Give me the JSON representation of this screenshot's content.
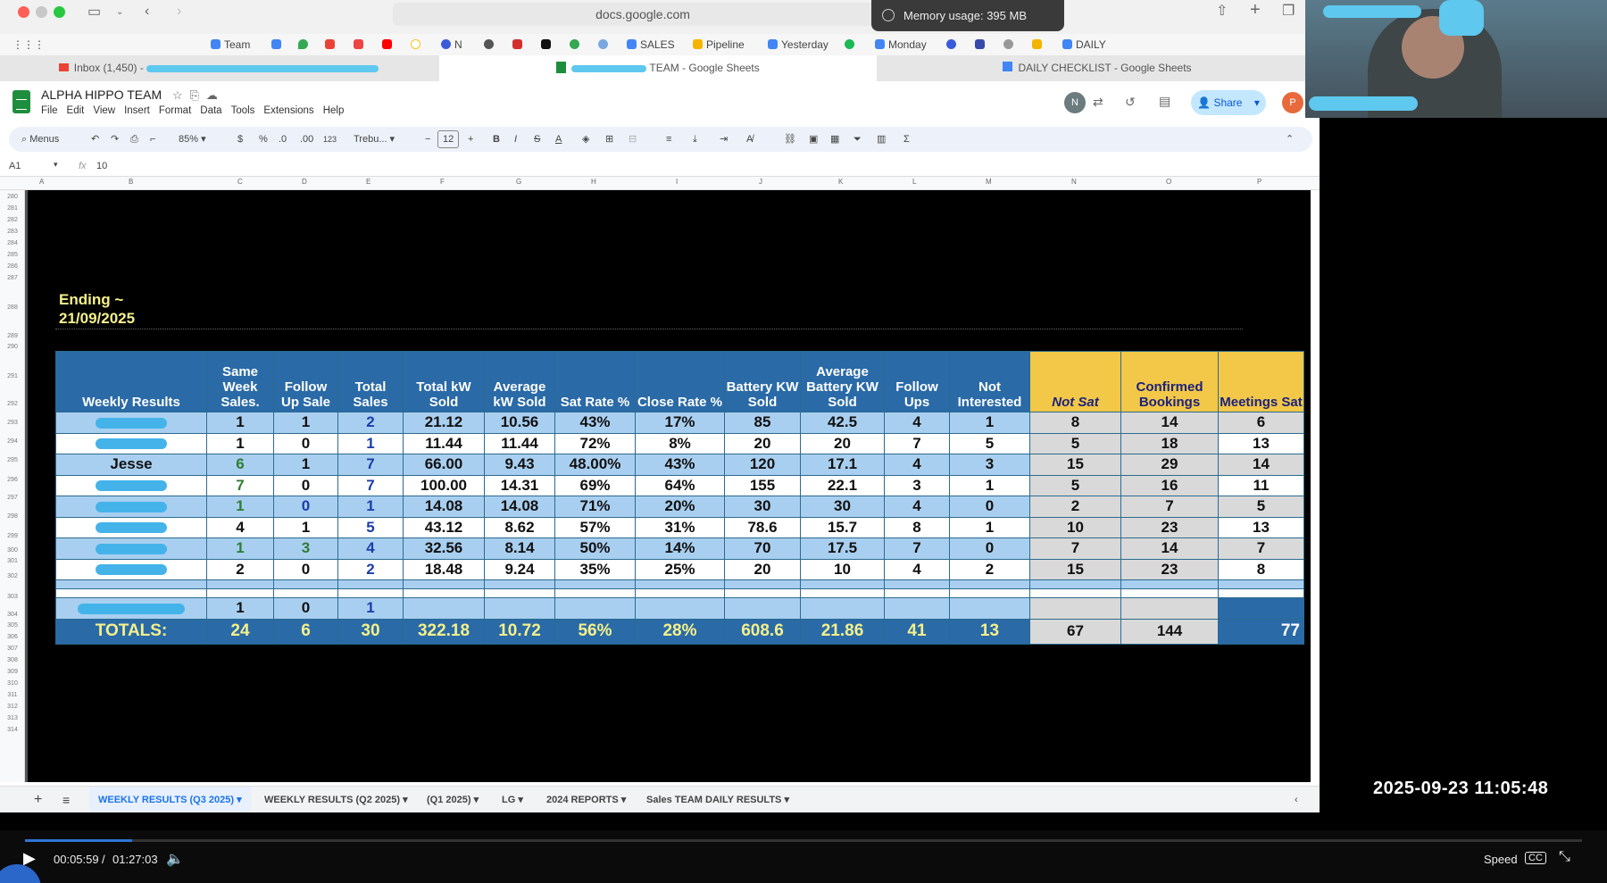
{
  "browser": {
    "url": "docs.google.com",
    "memory_label": "Memory usage: 395 MB",
    "bookmarks": [
      "Team",
      "N",
      "SALES",
      "Pipeline",
      "Yesterday",
      "Monday",
      "DAILY"
    ],
    "tabs": [
      "Inbox (1,450) -",
      "TEAM - Google Sheets",
      "DAILY CHECKLIST - Google Sheets"
    ]
  },
  "sheets": {
    "title": "ALPHA HIPPO TEAM",
    "menu": [
      "File",
      "Edit",
      "View",
      "Insert",
      "Format",
      "Data",
      "Tools",
      "Extensions",
      "Help"
    ],
    "share_label": "Share",
    "avatar_n": "N",
    "avatar_p": "P",
    "toolbar": {
      "menus": "Menus",
      "zoom": "85%",
      "dollar": "$",
      "percent": "%",
      "dec_less": ".0",
      "dec_more": ".00",
      "num_fmt": "123",
      "font": "Trebu...",
      "font_size": "12",
      "bold": "B",
      "italic": "I",
      "sum": "Σ"
    },
    "cell_ref": "A1",
    "fx_label": "fx",
    "formula": "10",
    "col_letters": [
      "A",
      "B",
      "C",
      "D",
      "E",
      "F",
      "G",
      "H",
      "I",
      "J",
      "K",
      "L",
      "M",
      "N",
      "O",
      "P"
    ],
    "row_numbers": [
      "280",
      "281",
      "282",
      "283",
      "284",
      "285",
      "286",
      "287",
      "288",
      "289",
      "290",
      "291",
      "292",
      "293",
      "294",
      "295",
      "296",
      "297",
      "298",
      "299",
      "300",
      "301",
      "302",
      "303",
      "304",
      "305",
      "306",
      "307",
      "308",
      "309",
      "310",
      "311",
      "312",
      "313",
      "314"
    ],
    "sheet_tabs": [
      "WEEKLY RESULTS (Q3 2025)",
      "WEEKLY RESULTS (Q2 2025)",
      "(Q1 2025)",
      "LG",
      "2024 REPORTS",
      "Sales TEAM DAILY RESULTS"
    ]
  },
  "report": {
    "ending_label": "Ending ~\n21/09/2025",
    "headers": [
      "Weekly Results",
      "Same Week Sales.",
      "Follow Up Sale",
      "Total Sales",
      "Total kW Sold",
      "Average kW Sold",
      "Sat Rate  %",
      "Close Rate %",
      "Battery KW Sold",
      "Average Battery KW Sold",
      "Follow Ups",
      "Not Interested",
      "Not Sat",
      "Confirmed Bookings",
      "Meetings Sat"
    ],
    "rows": [
      {
        "name": "",
        "same": "1",
        "follow": "1",
        "total": "2",
        "kw": "21.12",
        "avg_kw": "10.56",
        "sat": "43%",
        "close": "17%",
        "batt": "85",
        "avg_batt": "42.5",
        "fups": "4",
        "notint": "1",
        "notsat": "8",
        "conf": "14",
        "meet": "6"
      },
      {
        "name": "",
        "same": "1",
        "follow": "0",
        "total": "1",
        "kw": "11.44",
        "avg_kw": "11.44",
        "sat": "72%",
        "close": "8%",
        "batt": "20",
        "avg_batt": "20",
        "fups": "7",
        "notint": "5",
        "notsat": "5",
        "conf": "18",
        "meet": "13"
      },
      {
        "name": "Jesse",
        "same": "6",
        "follow": "1",
        "total": "7",
        "kw": "66.00",
        "avg_kw": "9.43",
        "sat": "48.00%",
        "close": "43%",
        "batt": "120",
        "avg_batt": "17.1",
        "fups": "4",
        "notint": "3",
        "notsat": "15",
        "conf": "29",
        "meet": "14"
      },
      {
        "name": "",
        "same": "7",
        "follow": "0",
        "total": "7",
        "kw": "100.00",
        "avg_kw": "14.31",
        "sat": "69%",
        "close": "64%",
        "batt": "155",
        "avg_batt": "22.1",
        "fups": "3",
        "notint": "1",
        "notsat": "5",
        "conf": "16",
        "meet": "11"
      },
      {
        "name": "",
        "same": "1",
        "follow": "0",
        "total": "1",
        "kw": "14.08",
        "avg_kw": "14.08",
        "sat": "71%",
        "close": "20%",
        "batt": "30",
        "avg_batt": "30",
        "fups": "4",
        "notint": "0",
        "notsat": "2",
        "conf": "7",
        "meet": "5"
      },
      {
        "name": "",
        "same": "4",
        "follow": "1",
        "total": "5",
        "kw": "43.12",
        "avg_kw": "8.62",
        "sat": "57%",
        "close": "31%",
        "batt": "78.6",
        "avg_batt": "15.7",
        "fups": "8",
        "notint": "1",
        "notsat": "10",
        "conf": "23",
        "meet": "13"
      },
      {
        "name": "",
        "same": "1",
        "follow": "3",
        "total": "4",
        "kw": "32.56",
        "avg_kw": "8.14",
        "sat": "50%",
        "close": "14%",
        "batt": "70",
        "avg_batt": "17.5",
        "fups": "7",
        "notint": "0",
        "notsat": "7",
        "conf": "14",
        "meet": "7"
      },
      {
        "name": "",
        "same": "2",
        "follow": "0",
        "total": "2",
        "kw": "18.48",
        "avg_kw": "9.24",
        "sat": "35%",
        "close": "25%",
        "batt": "20",
        "avg_batt": "10",
        "fups": "4",
        "notint": "2",
        "notsat": "15",
        "conf": "23",
        "meet": "8"
      }
    ],
    "extra_row": {
      "same": "1",
      "follow": "0",
      "total": "1"
    },
    "totals": {
      "label": "TOTALS:",
      "same": "24",
      "follow": "6",
      "total": "30",
      "kw": "322.18",
      "avg_kw": "10.72",
      "sat": "56%",
      "close": "28%",
      "batt": "608.6",
      "avg_batt": "21.86",
      "fups": "41",
      "notint": "13",
      "notsat": "67",
      "conf": "144",
      "meet": "77"
    }
  },
  "overlay": {
    "timestamp": "2025-09-23  11:05:48"
  },
  "player": {
    "current": "00:05:59",
    "sep": "/",
    "duration": "01:27:03",
    "speed_label": "Speed",
    "cc_label": "CC",
    "progress": 0.069
  },
  "colors": {
    "header_blue": "#2a6aa7",
    "row_blue": "#a9cff0",
    "header_yellow": "#f3c747",
    "totals_text": "#f5f08a"
  }
}
